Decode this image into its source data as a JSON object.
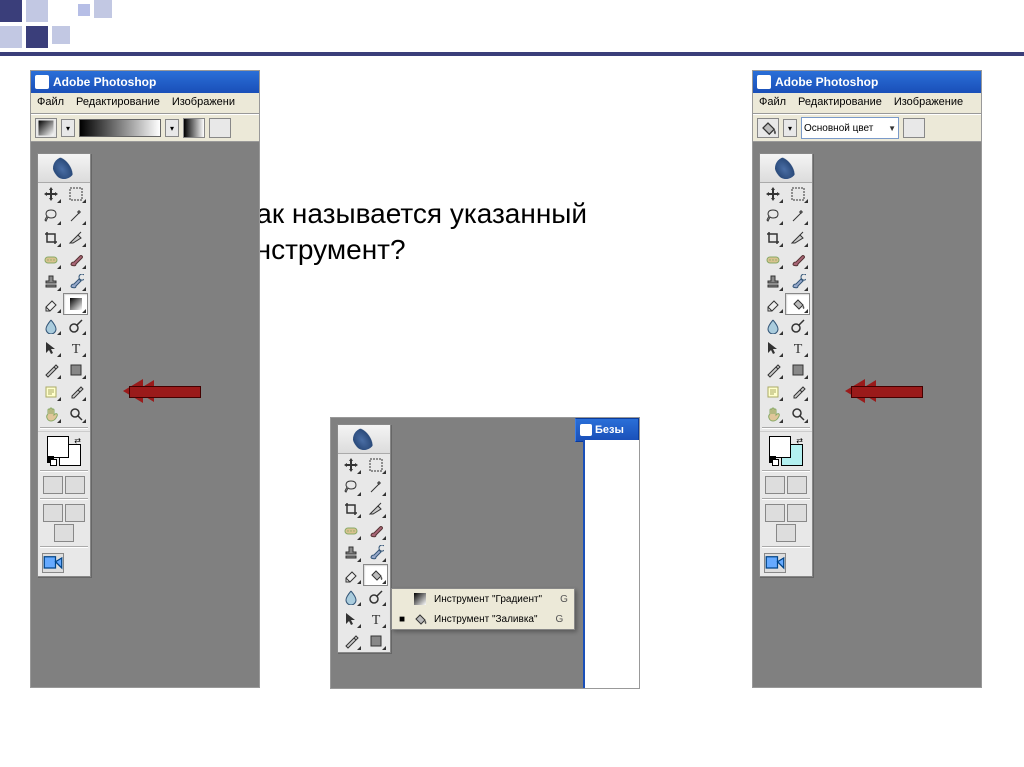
{
  "question": {
    "line1": "Как называется указанный",
    "line2": "инструмент?"
  },
  "app_title": "Adobe Photoshop",
  "menus": {
    "file": "Файл",
    "edit": "Редактирование",
    "image_full": "Изображение",
    "image_cut": "Изображени"
  },
  "optbar_c": {
    "label": "Основной цвет"
  },
  "flyout": {
    "gradient": {
      "label": "Инструмент \"Градиент\"",
      "shortcut": "G"
    },
    "bucket": {
      "label": "Инструмент \"Заливка\"",
      "shortcut": "G"
    }
  },
  "doc_tab": "Безы",
  "tool_names": [
    "move",
    "marquee",
    "lasso",
    "wand",
    "crop",
    "slice",
    "healing",
    "brush",
    "stamp",
    "history-brush",
    "eraser",
    "gradient",
    "blur",
    "dodge",
    "path-select",
    "type",
    "pen",
    "shape",
    "notes",
    "eyedropper",
    "hand",
    "zoom"
  ]
}
